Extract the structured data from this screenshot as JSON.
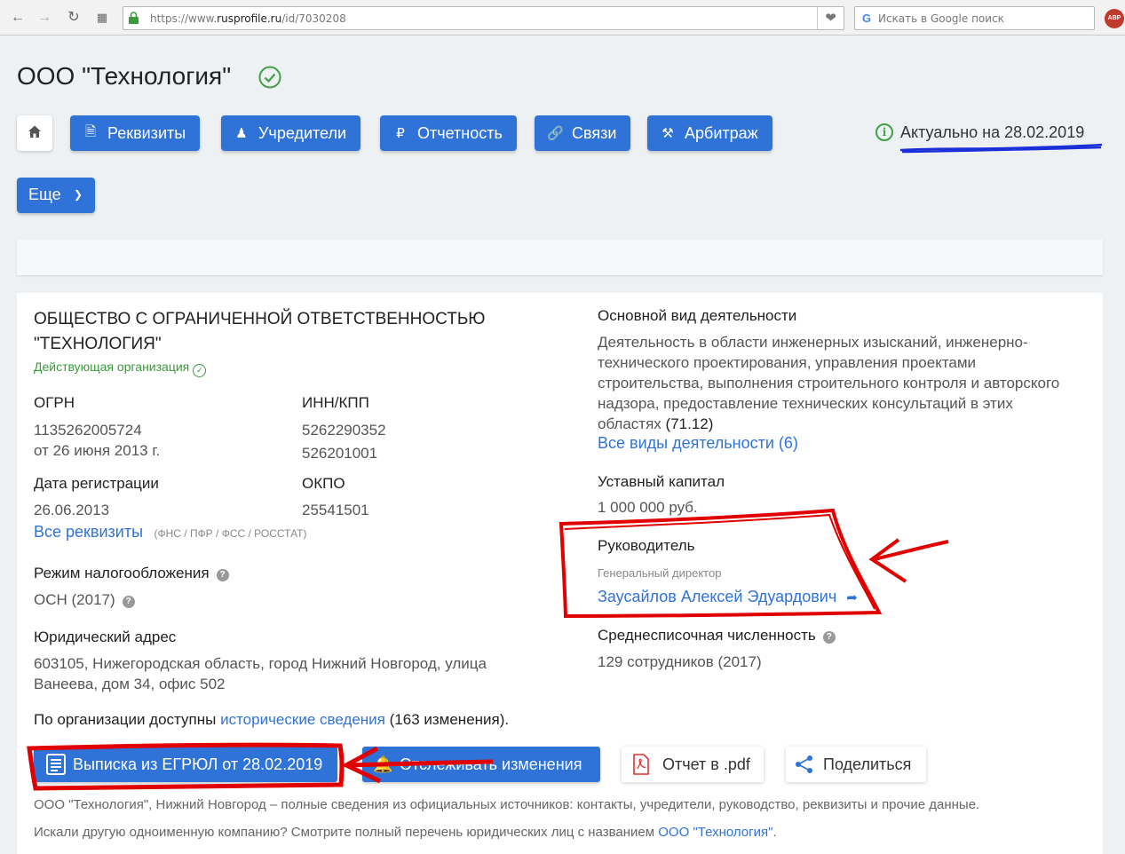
{
  "browser": {
    "url_prefix": "https://www.",
    "url_domain": "rusprofile.ru",
    "url_path": "/id/7030208",
    "search_placeholder": "Искать в Google поиск"
  },
  "header": {
    "company_title": "ООО \"Технология\"",
    "tabs": [
      {
        "label": "Реквизиты",
        "icon": "document-icon"
      },
      {
        "label": "Учредители",
        "icon": "users-icon"
      },
      {
        "label": "Отчетность",
        "icon": "ruble-icon"
      },
      {
        "label": "Связи",
        "icon": "link-icon"
      },
      {
        "label": "Арбитраж",
        "icon": "gavel-icon"
      }
    ],
    "more_label": "Еще",
    "actual_text": "Актуально на 28.02.2019"
  },
  "company": {
    "full_name": "ОБЩЕСТВО С ОГРАНИЧЕННОЙ ОТВЕТСТВЕННОСТЬЮ \"ТЕХНОЛОГИЯ\"",
    "status": "Действующая организация",
    "ogrn_label": "ОГРН",
    "ogrn_value": "1135262005724",
    "ogrn_date": "от 26 июня 2013 г.",
    "inn_label": "ИНН/КПП",
    "inn_value": "5262290352",
    "kpp_value": "526201001",
    "reg_date_label": "Дата регистрации",
    "reg_date_value": "26.06.2013",
    "okpo_label": "ОКПО",
    "okpo_value": "25541501",
    "all_requisites_link": "Все реквизиты",
    "all_requisites_note": "(ФНС / ПФР / ФСС / РОССТАТ)",
    "tax_label": "Режим налогообложения",
    "tax_value": "ОСН (2017)",
    "address_label": "Юридический адрес",
    "address_value": "603105, Нижегородская область, город Нижний Новгород, улица Ванеева, дом 34, офис 502",
    "history_prefix": "По организации доступны",
    "history_link": "исторические сведения",
    "history_suffix": "(163 изменения)."
  },
  "activity": {
    "label": "Основной вид деятельности",
    "text": "Деятельность в области инженерных изысканий, инженерно-технического проектирования, управления проектами строительства, выполнения строительного контроля и авторского надзора, предоставление технических консультаций в этих областях",
    "code": "(71.12)",
    "all_link": "Все виды деятельности (6)",
    "capital_label": "Уставный капитал",
    "capital_value": "1 000 000 руб.",
    "head_label": "Руководитель",
    "head_position": "Генеральный директор",
    "head_name": "Заусайлов Алексей Эдуардович",
    "staff_label": "Среднесписочная численность",
    "staff_value": "129 сотрудников (2017)"
  },
  "actions": {
    "egrul": "Выписка из ЕГРЮЛ от 28.02.2019",
    "track": "Отслеживать изменения",
    "pdf": "Отчет в .pdf",
    "share": "Поделиться"
  },
  "footer": {
    "line1": "ООО \"Технология\", Нижний Новгород – полные сведения из официальных источников: контакты, учредители, руководство, реквизиты и прочие данные.",
    "line2_prefix": "Искали другую одноименную компанию? Смотрите полный перечень юридических лиц с названием",
    "line2_link": "ООО \"Технология\"",
    "line2_suffix": "."
  },
  "colors": {
    "primary": "#2f73d9",
    "success": "#3a9a3c",
    "annotation": "#e00000",
    "annotation_blue": "#1a2fd8"
  }
}
